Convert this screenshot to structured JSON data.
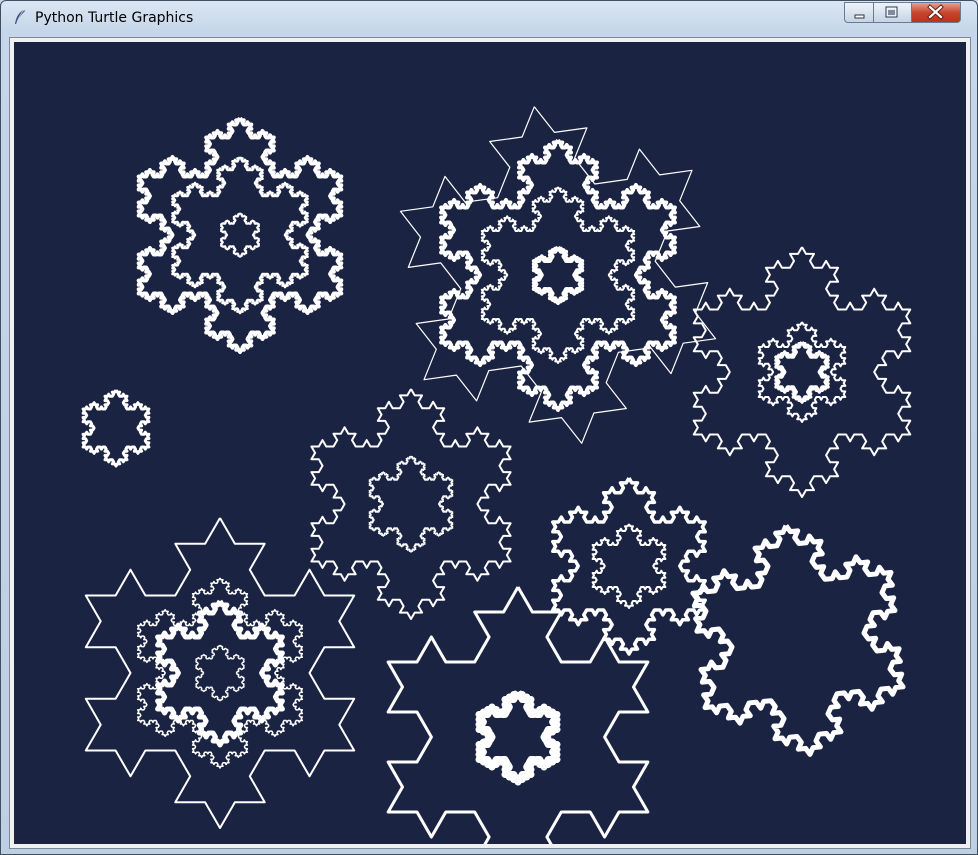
{
  "window": {
    "title": "Python Turtle Graphics",
    "icon": "feather-icon",
    "controls": [
      "minimize-icon",
      "maximize-icon",
      "close-icon"
    ]
  },
  "canvas": {
    "background": "#1b2343",
    "pen_color": "#ffffff",
    "subject": "Koch snowflake fractal outlines"
  }
}
